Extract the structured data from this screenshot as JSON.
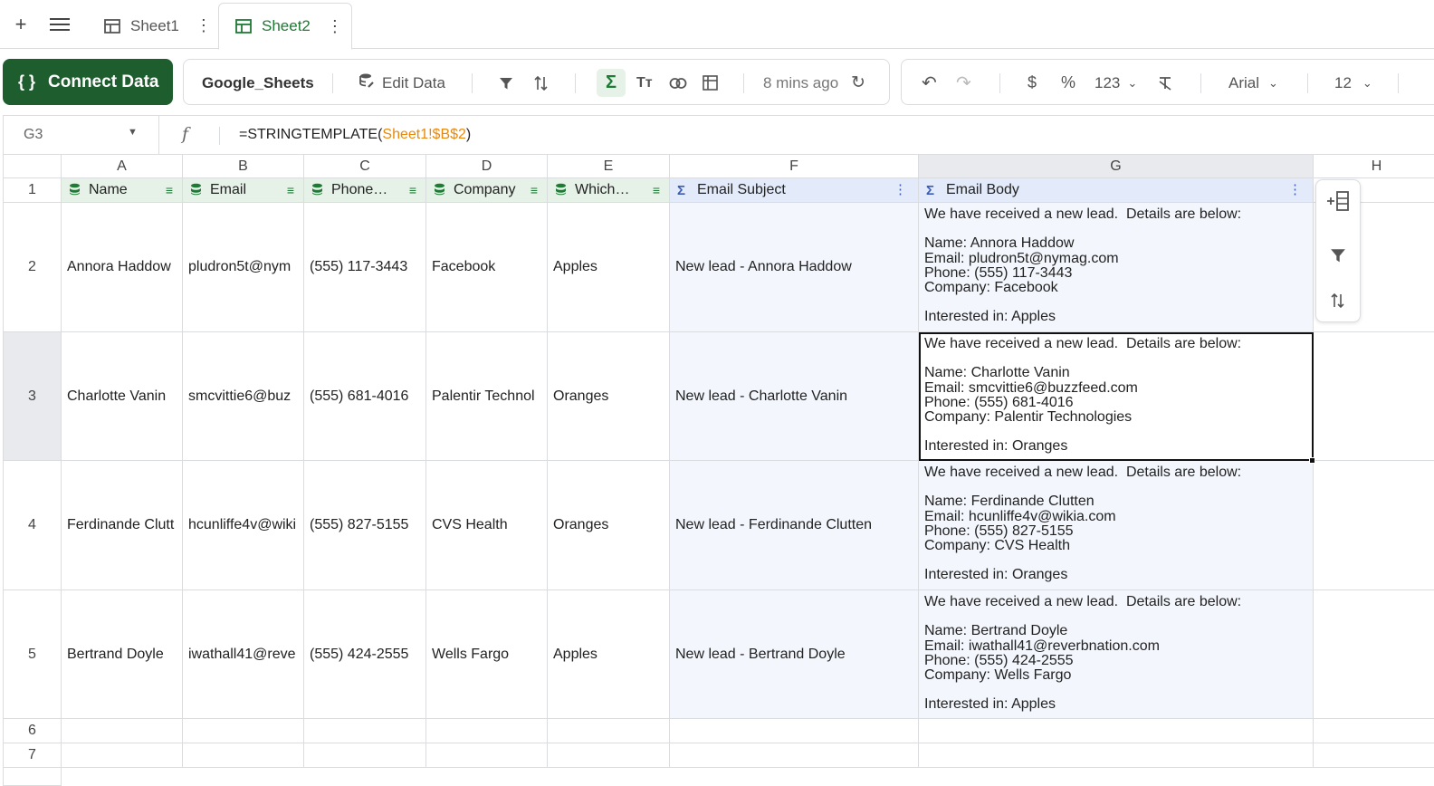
{
  "tabs": [
    {
      "label": "Sheet1",
      "active": false
    },
    {
      "label": "Sheet2",
      "active": true
    }
  ],
  "toolbar": {
    "connect_label": "Connect Data",
    "source_label": "Google_Sheets",
    "edit_label": "Edit Data",
    "updated": "8 mins ago",
    "number_format": "123",
    "font": "Arial",
    "font_size": "12"
  },
  "formula_bar": {
    "cell_ref": "G3",
    "formula_prefix": "=STRINGTEMPLATE(",
    "formula_ref": "Sheet1!$B$2",
    "formula_suffix": ")"
  },
  "columns": [
    "A",
    "B",
    "C",
    "D",
    "E",
    "F",
    "G",
    "H"
  ],
  "row_numbers": [
    "1",
    "2",
    "3",
    "4",
    "5",
    "6",
    "7"
  ],
  "headers": [
    "Name",
    "Email",
    "Phone…",
    "Company",
    "Which…",
    "Email Subject",
    "Email Body"
  ],
  "rows": [
    {
      "name": "Annora Haddow",
      "email": "pludron5t@nym",
      "phone": "(555) 117-3443",
      "company": "Facebook",
      "which": "Apples",
      "subject": "New lead - Annora Haddow",
      "body": "We have received a new lead.  Details are below:\n\nName: Annora Haddow\nEmail: pludron5t@nymag.com\nPhone: (555) 117-3443\nCompany: Facebook\n\nInterested in: Apples"
    },
    {
      "name": "Charlotte Vanin",
      "email": "smcvittie6@buz",
      "phone": "(555) 681-4016",
      "company": "Palentir Technol",
      "which": "Oranges",
      "subject": "New lead - Charlotte Vanin",
      "body": "We have received a new lead.  Details are below:\n\nName: Charlotte Vanin\nEmail: smcvittie6@buzzfeed.com\nPhone: (555) 681-4016\nCompany: Palentir Technologies\n\nInterested in: Oranges"
    },
    {
      "name": "Ferdinande Clutt",
      "email": "hcunliffe4v@wiki",
      "phone": "(555) 827-5155",
      "company": "CVS Health",
      "which": "Oranges",
      "subject": "New lead - Ferdinande Clutten",
      "body": "We have received a new lead.  Details are below:\n\nName: Ferdinande Clutten\nEmail: hcunliffe4v@wikia.com\nPhone: (555) 827-5155\nCompany: CVS Health\n\nInterested in: Oranges"
    },
    {
      "name": "Bertrand Doyle",
      "email": "iwathall41@reve",
      "phone": "(555) 424-2555",
      "company": "Wells Fargo",
      "which": "Apples",
      "subject": "New lead - Bertrand Doyle",
      "body": "We have received a new lead.  Details are below:\n\nName: Bertrand Doyle\nEmail: iwathall41@reverbnation.com\nPhone: (555) 424-2555\nCompany: Wells Fargo\n\nInterested in: Apples"
    }
  ],
  "colors": {
    "brand_green": "#1e5e2e",
    "source_header": "#e6f2e8",
    "calc_header": "#e3ebfb",
    "formula_ref": "#e8890c"
  },
  "icons": [
    "plus-icon",
    "menu-icon",
    "sheet-icon",
    "kebab-icon",
    "filter-icon",
    "sort-icon",
    "sigma-icon",
    "text-size-icon",
    "link-icon",
    "pivot-icon",
    "refresh-icon",
    "undo-icon",
    "redo-icon",
    "dollar-icon",
    "percent-icon",
    "clear-format-icon",
    "add-column-icon"
  ]
}
